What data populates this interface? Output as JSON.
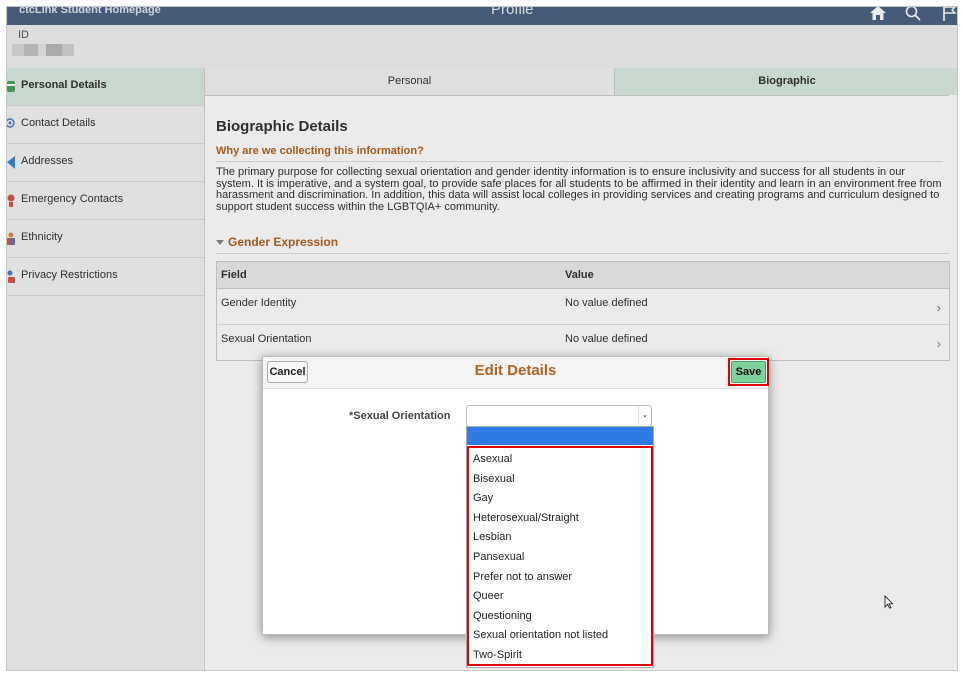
{
  "header": {
    "home_link": "ctcLink Student Homepage",
    "page_title": "Profile",
    "icons": [
      "home-icon",
      "search-icon",
      "flag-icon"
    ]
  },
  "id_bar": {
    "label": "ID"
  },
  "sidebar": {
    "items": [
      {
        "label": "Personal Details",
        "icon": "personal-details-icon",
        "active": true
      },
      {
        "label": "Contact Details",
        "icon": "contact-details-icon"
      },
      {
        "label": "Addresses",
        "icon": "addresses-icon"
      },
      {
        "label": "Emergency Contacts",
        "icon": "emergency-contacts-icon"
      },
      {
        "label": "Ethnicity",
        "icon": "ethnicity-icon"
      },
      {
        "label": "Privacy Restrictions",
        "icon": "privacy-restrictions-icon"
      }
    ]
  },
  "tabs": {
    "personal": "Personal",
    "biographic": "Biographic"
  },
  "main": {
    "title": "Biographic Details",
    "why_heading": "Why are we collecting this information?",
    "paragraph": "The primary purpose for collecting sexual orientation and gender identity information is to ensure inclusivity and success for all students in our system. It is imperative, and a system goal, to provide safe places for all students to be affirmed in their identity and learn in an environment free from harassment and discrimination. In addition, this data will assist local colleges in providing services and creating programs and curriculum designed to support student success within the LGBTQIA+ community.",
    "gender_expression": "Gender Expression",
    "table": {
      "headers": {
        "field": "Field",
        "value": "Value"
      },
      "rows": [
        {
          "field": "Gender Identity",
          "value": "No value defined"
        },
        {
          "field": "Sexual Orientation",
          "value": "No value defined"
        }
      ]
    }
  },
  "modal": {
    "cancel": "Cancel",
    "title": "Edit Details",
    "save": "Save",
    "field_label": "*Sexual Orientation",
    "select_value": "",
    "options": [
      "Asexual",
      "Bisexual",
      "Gay",
      "Heterosexual/Straight",
      "Lesbian",
      "Pansexual",
      "Prefer not to answer",
      "Queer",
      "Questioning",
      "Sexual orientation not listed",
      "Two-Spirit"
    ]
  },
  "colors": {
    "header_bg": "#4c6385",
    "accent_orange": "#b3621f",
    "active_green": "#d9ebe0",
    "save_green": "#7dd19a",
    "highlight_red": "#dd0000",
    "selected_blue": "#2f7ae5"
  }
}
